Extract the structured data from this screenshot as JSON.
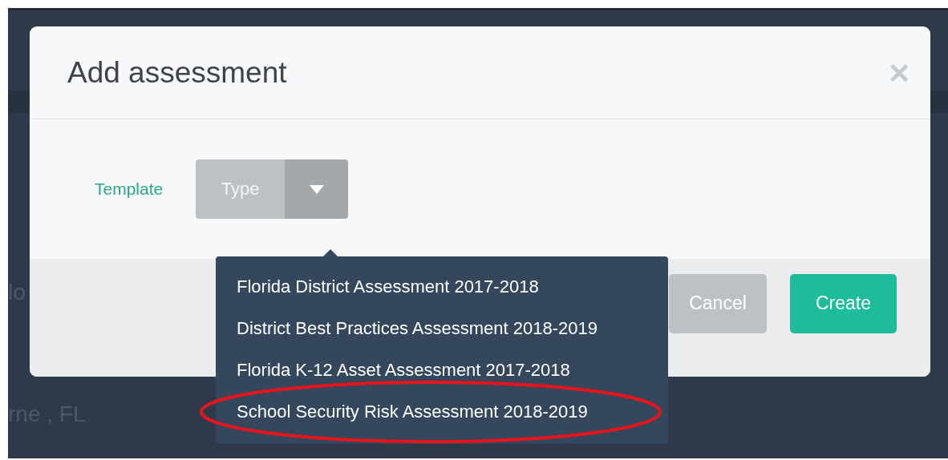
{
  "background": {
    "texts": [
      "lo",
      "rne , FL"
    ]
  },
  "dialog": {
    "title": "Add assessment",
    "close": "×",
    "field": {
      "label": "Template",
      "placeholder": "Type",
      "expanded": true
    },
    "options": [
      {
        "label": "Florida District Assessment 2017-2018",
        "circled": false
      },
      {
        "label": "District Best Practices Assessment 2018-2019",
        "circled": false
      },
      {
        "label": "Florida K-12 Asset Assessment 2017-2018",
        "circled": false
      },
      {
        "label": "School Security Risk Assessment 2018-2019",
        "circled": true
      }
    ],
    "buttons": [
      {
        "label": "Cancel",
        "kind": "secondary"
      },
      {
        "label": "Create",
        "kind": "primary"
      }
    ]
  }
}
